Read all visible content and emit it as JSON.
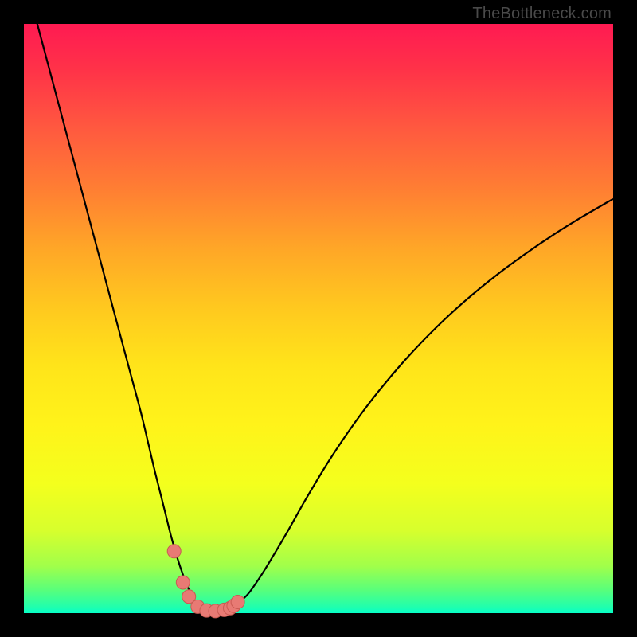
{
  "watermark": "TheBottleneck.com",
  "colors": {
    "frame": "#000000",
    "curve": "#000000",
    "marker_fill": "#e87a74",
    "marker_stroke": "#c95a52",
    "gradient_top": "#ff1a52",
    "gradient_bottom": "#06ffc8"
  },
  "chart_data": {
    "type": "line",
    "title": "",
    "xlabel": "",
    "ylabel": "",
    "xlim": [
      0,
      100
    ],
    "ylim": [
      0,
      100
    ],
    "x": [
      0,
      2,
      4,
      6,
      8,
      10,
      12,
      14,
      16,
      18,
      20,
      22,
      23,
      24,
      25,
      26,
      27,
      28,
      29,
      30,
      31,
      32,
      33,
      34,
      35,
      36,
      38,
      40,
      42,
      45,
      48,
      52,
      56,
      60,
      65,
      70,
      75,
      80,
      85,
      90,
      95,
      100
    ],
    "values": [
      108,
      101,
      93.5,
      86,
      78.5,
      71,
      63.5,
      56,
      48.5,
      41,
      33.5,
      25,
      21,
      17,
      13,
      9.5,
      6.5,
      4,
      2.2,
      1.0,
      0.4,
      0.3,
      0.3,
      0.4,
      0.7,
      1.4,
      3.2,
      6,
      9.2,
      14.3,
      19.6,
      26.2,
      32.1,
      37.4,
      43.3,
      48.5,
      53.1,
      57.2,
      60.9,
      64.3,
      67.4,
      70.3
    ],
    "markers": {
      "x": [
        25.5,
        27.0,
        28.0,
        29.5,
        31.0,
        32.5,
        34.0,
        35.0,
        35.6,
        36.3
      ],
      "y": [
        10.5,
        5.2,
        2.8,
        1.1,
        0.45,
        0.35,
        0.55,
        0.85,
        1.25,
        1.9
      ]
    }
  }
}
